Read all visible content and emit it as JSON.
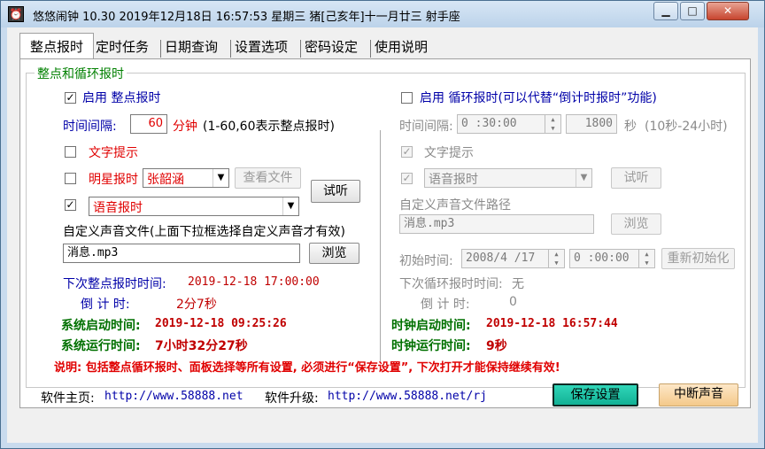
{
  "title": "悠悠闹钟 10.30 2019年12月18日 16:57:53 星期三 猪[己亥年]十一月廿三 射手座",
  "caption_buttons": {
    "minimize": "▁",
    "maximize": "□",
    "close": "✕"
  },
  "tabs": [
    "整点报时",
    "定时任务",
    "日期查询",
    "设置选项",
    "密码设定",
    "使用说明"
  ],
  "group_title": "整点和循环报时",
  "left": {
    "enable_label": "启用 整点报时",
    "enable_check": "✓",
    "interval_label": "时间间隔:",
    "interval_value": "60",
    "interval_unit": "分钟",
    "interval_hint": "(1-60,60表示整点报时)",
    "text_prompt_label": "文字提示",
    "star_label": "明星报时",
    "star_value": "张韶涵",
    "view_file_button": "查看文件",
    "trial_button": "试听",
    "voice_check": "✓",
    "voice_value": "语音报时",
    "custom_sound_label": "自定义声音文件(上面下拉框选择自定义声音才有效)",
    "custom_sound_value": "消息.mp3",
    "browse_button": "浏览",
    "next_label": "下次整点报时时间:",
    "next_value": "2019-12-18 17:00:00",
    "countdown_label": "倒 计 时:",
    "countdown_value": "2分7秒"
  },
  "right": {
    "enable_label": "启用 循环报时(可以代替“倒计时报时”功能)",
    "interval_label": "时间间隔:",
    "interval_value": "0 :30:00",
    "seconds_value": "1800",
    "seconds_unit": "秒",
    "seconds_hint": "(10秒-24小时)",
    "text_prompt_label": "文字提示",
    "text_prompt_check": "✓",
    "voice_check": "✓",
    "voice_value": "语音报时",
    "trial_button": "试听",
    "custom_path_label": "自定义声音文件路径",
    "custom_path_value": "消息.mp3",
    "browse_button": "浏览",
    "init_label": "初始时间:",
    "init_date": "2008/4 /17",
    "init_time": "0 :00:00",
    "reinit_button": "重新初始化",
    "next_label": "下次循环报时时间:",
    "next_value": "无",
    "countdown_label": "倒 计 时:",
    "countdown_value": "0"
  },
  "status": {
    "sys_start_label": "系统启动时间:",
    "sys_start_value": "2019-12-18 09:25:26",
    "sys_run_label": "系统运行时间:",
    "sys_run_value": "7小时32分27秒",
    "clock_start_label": "时钟启动时间:",
    "clock_start_value": "2019-12-18 16:57:44",
    "clock_run_label": "时钟运行时间:",
    "clock_run_value": "9秒"
  },
  "note": "说明: 包括整点循环报时、面板选择等所有设置, 必须进行“保存设置”, 下次打开才能保持继续有效!",
  "footer": {
    "home_label": "软件主页:",
    "home_url": "http://www.58888.net",
    "upgrade_label": "软件升级:",
    "upgrade_url": "http://www.58888.net/rj",
    "save_button": "保存设置",
    "stop_button": "中断声音"
  }
}
